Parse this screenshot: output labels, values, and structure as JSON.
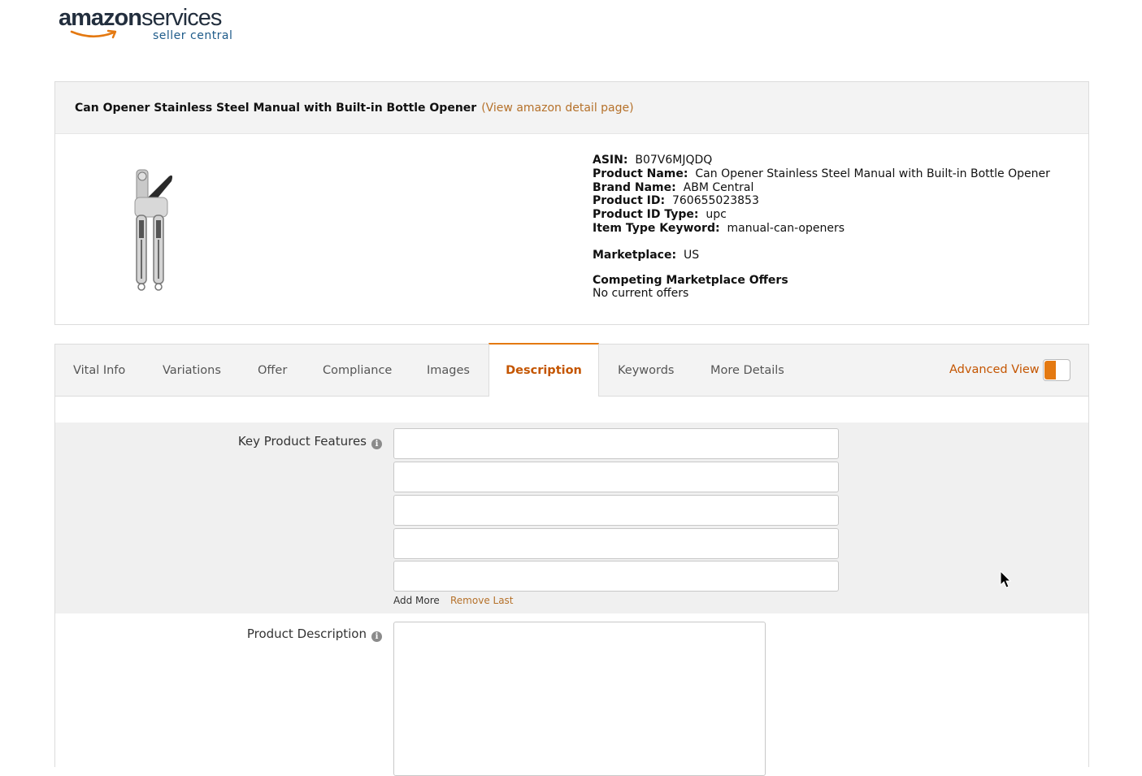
{
  "logo": {
    "word_amazon": "amazon",
    "word_services": "services",
    "sub": "seller central"
  },
  "product": {
    "title": "Can Opener Stainless Steel Manual with Built-in Bottle Opener",
    "view_link": "(View amazon detail page)",
    "details": [
      {
        "key": "ASIN:",
        "value": "B07V6MJQDQ"
      },
      {
        "key": "Product Name:",
        "value": "Can Opener Stainless Steel Manual with Built-in Bottle Opener"
      },
      {
        "key": "Brand Name:",
        "value": "ABM Central"
      },
      {
        "key": "Product ID:",
        "value": "760655023853"
      },
      {
        "key": "Product ID Type:",
        "value": "upc"
      },
      {
        "key": "Item Type Keyword:",
        "value": "manual-can-openers"
      }
    ],
    "marketplace_key": "Marketplace:",
    "marketplace_value": "US",
    "competing_title": "Competing Marketplace Offers",
    "competing_value": "No current offers"
  },
  "tabs": [
    {
      "label": "Vital Info"
    },
    {
      "label": "Variations"
    },
    {
      "label": "Offer"
    },
    {
      "label": "Compliance"
    },
    {
      "label": "Images"
    },
    {
      "label": "Description",
      "active": true
    },
    {
      "label": "Keywords"
    },
    {
      "label": "More Details"
    }
  ],
  "advanced_view": {
    "label": "Advanced View",
    "on": false
  },
  "form": {
    "key_features_label": "Key Product Features",
    "key_features_values": [
      "",
      "",
      "",
      "",
      ""
    ],
    "add_more": "Add More",
    "remove_last": "Remove Last",
    "description_label": "Product Description",
    "description_value": ""
  },
  "colors": {
    "accent": "#e47911",
    "link": "#b5712a",
    "active_tab_text": "#c45500"
  }
}
